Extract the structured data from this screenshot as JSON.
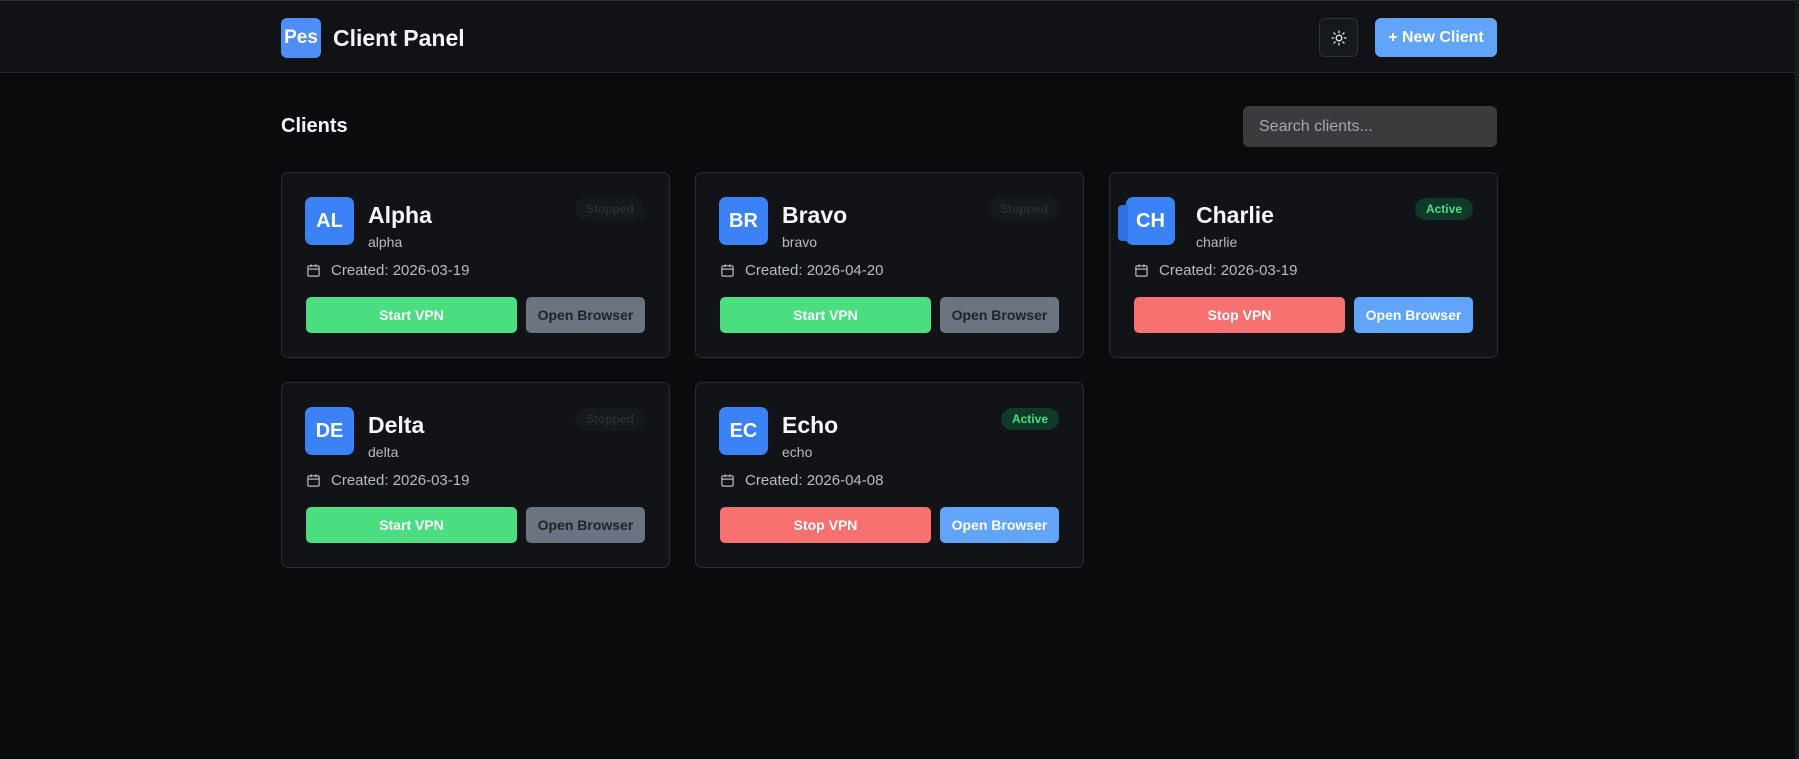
{
  "header": {
    "logo_text": "Pes",
    "title": "Client Panel",
    "theme_icon": "sun-icon",
    "new_client_label": "+ New Client"
  },
  "main": {
    "section_title": "Clients",
    "search_placeholder": "Search clients..."
  },
  "colors": {
    "accent": "#60a5fa",
    "start": "#4ade80",
    "stop": "#f87171",
    "avatar": "#3b82f6"
  },
  "clients": [
    {
      "initials": "AL",
      "name": "Alpha",
      "slug": "alpha",
      "status": "Stopped",
      "created": "Created: 2026-03-19",
      "vpn_label": "Start VPN",
      "browser_label": "Open Browser"
    },
    {
      "initials": "BR",
      "name": "Bravo",
      "slug": "bravo",
      "status": "Stopped",
      "created": "Created: 2026-04-20",
      "vpn_label": "Start VPN",
      "browser_label": "Open Browser"
    },
    {
      "initials": "CH",
      "name": "Charlie",
      "slug": "charlie",
      "status": "Active",
      "created": "Created: 2026-03-19",
      "vpn_label": "Stop VPN",
      "browser_label": "Open Browser"
    },
    {
      "initials": "DE",
      "name": "Delta",
      "slug": "delta",
      "status": "Stopped",
      "created": "Created: 2026-03-19",
      "vpn_label": "Start VPN",
      "browser_label": "Open Browser"
    },
    {
      "initials": "EC",
      "name": "Echo",
      "slug": "echo",
      "status": "Active",
      "created": "Created: 2026-04-08",
      "vpn_label": "Stop VPN",
      "browser_label": "Open Browser"
    }
  ]
}
